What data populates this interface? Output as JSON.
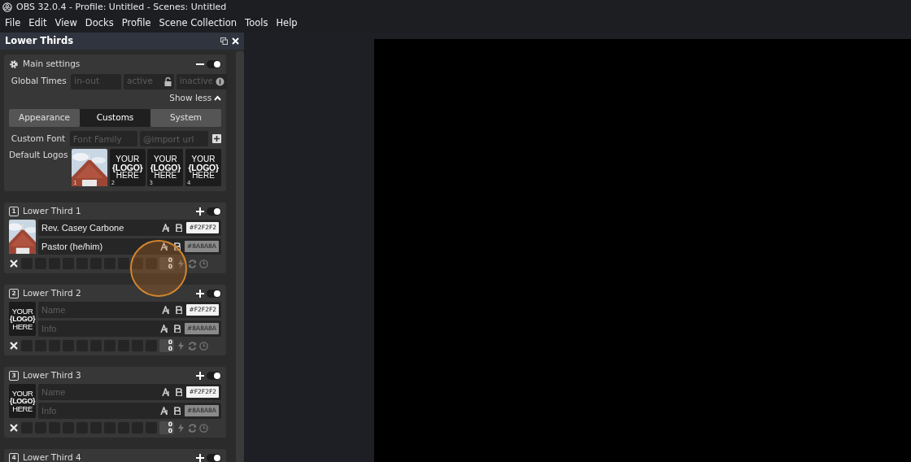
{
  "window": {
    "title": "OBS 32.0.4 - Profile: Untitled - Scenes: Untitled"
  },
  "menu": [
    "File",
    "Edit",
    "View",
    "Docks",
    "Profile",
    "Scene Collection",
    "Tools",
    "Help"
  ],
  "dock": {
    "title": "Lower Thirds",
    "main_settings": {
      "title": "Main settings",
      "on": true,
      "global_times": {
        "label": "Global Times",
        "fields": [
          {
            "placeholder": "in-out"
          },
          {
            "placeholder": "active"
          },
          {
            "placeholder": "inactive"
          }
        ]
      },
      "show_less": "Show less",
      "tabs": [
        {
          "label": "Appearance",
          "selected": false
        },
        {
          "label": "Customs",
          "selected": true
        },
        {
          "label": "System",
          "selected": false
        }
      ],
      "custom_font": {
        "label": "Custom Font",
        "fields": [
          {
            "placeholder": "Font Family"
          },
          {
            "placeholder": "@import url"
          }
        ]
      },
      "default_logos": {
        "label": "Default Logos",
        "logos": [
          {
            "kind": "picture",
            "index": "1"
          },
          {
            "kind": "placeholder",
            "lines": [
              "YOUR",
              "{LOGO}",
              "HERE"
            ],
            "index": "2"
          },
          {
            "kind": "placeholder",
            "lines": [
              "YOUR",
              "{LOGO}",
              "HERE"
            ],
            "index": "3"
          },
          {
            "kind": "placeholder",
            "lines": [
              "YOUR",
              "{LOGO}",
              "HERE"
            ],
            "index": "4"
          }
        ]
      }
    },
    "lower_thirds": [
      {
        "number": "1",
        "title": "Lower Third 1",
        "on": true,
        "logo": {
          "kind": "picture"
        },
        "name": {
          "value": "Rev. Casey Carbone",
          "color": "#F2F2F2"
        },
        "info": {
          "value": "Pastor (he/him)",
          "color": "#8A8A8A"
        },
        "counter": [
          "0",
          "0"
        ]
      },
      {
        "number": "2",
        "title": "Lower Third 2",
        "on": true,
        "logo": {
          "kind": "placeholder",
          "lines": [
            "YOUR",
            "{LOGO}",
            "HERE"
          ]
        },
        "name": {
          "placeholder": "Name",
          "color": "#F2F2F2"
        },
        "info": {
          "placeholder": "Info",
          "color": "#8A8A8A"
        },
        "counter": [
          "0",
          "0"
        ]
      },
      {
        "number": "3",
        "title": "Lower Third 3",
        "on": true,
        "logo": {
          "kind": "placeholder",
          "lines": [
            "YOUR",
            "{LOGO}",
            "HERE"
          ]
        },
        "name": {
          "placeholder": "Name",
          "color": "#F2F2F2"
        },
        "info": {
          "placeholder": "Info",
          "color": "#8A8A8A"
        },
        "counter": [
          "0",
          "0"
        ]
      },
      {
        "number": "4",
        "title": "Lower Third 4",
        "on": true
      }
    ]
  }
}
